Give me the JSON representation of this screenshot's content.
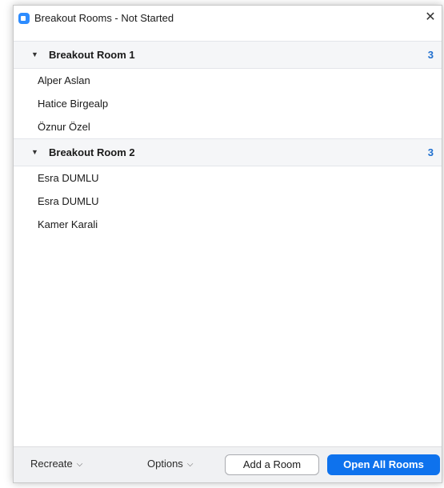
{
  "window": {
    "title": "Breakout Rooms - Not Started",
    "close_glyph": "✕"
  },
  "rooms": [
    {
      "name": "Breakout Room 1",
      "count": "3",
      "expanded": true,
      "participants": [
        "Alper Aslan",
        "Hatice Birgealp",
        "Öznur Özel"
      ]
    },
    {
      "name": "Breakout Room 2",
      "count": "3",
      "expanded": true,
      "participants": [
        "Esra DUMLU",
        "Esra DUMLU",
        "Kamer Karali"
      ]
    }
  ],
  "footer": {
    "recreate_label": "Recreate",
    "options_label": "Options",
    "add_room_label": "Add a Room",
    "open_all_label": "Open All Rooms"
  },
  "icons": {
    "app": "zoom-app-icon",
    "close": "close-icon",
    "caret": "caret-down-icon",
    "chevron": "chevron-down-icon"
  },
  "colors": {
    "accent": "#0e72ed",
    "count": "#1f6fcf",
    "room_header_bg": "#f5f6f8",
    "footer_bg": "#f0f1f3"
  }
}
